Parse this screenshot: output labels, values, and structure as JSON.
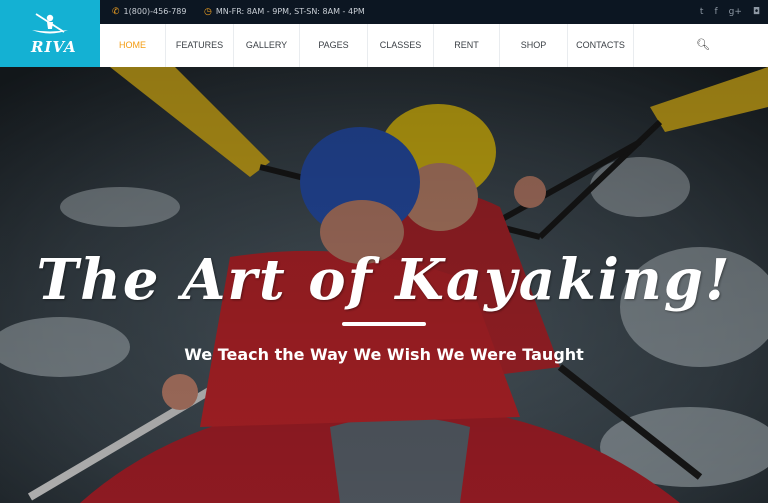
{
  "brand": {
    "name": "RIVA",
    "logo_icon": "kayaker-logo-icon",
    "color": "#14b1d3"
  },
  "info": {
    "phone_icon": "phone-icon",
    "phone": "1(800)-456-789",
    "hours_icon": "clock-icon",
    "hours": "MN-FR: 8AM - 9PM, ST-SN: 8AM - 4PM"
  },
  "social": [
    "twitter-icon",
    "facebook-icon",
    "google-plus-icon",
    "instagram-icon"
  ],
  "social_glyphs": {
    "twitter": "t",
    "facebook": "f",
    "google_plus": "g+",
    "instagram": "◘"
  },
  "nav": {
    "items": [
      "HOME",
      "FEATURES",
      "GALLERY",
      "PAGES",
      "CLASSES",
      "RENT",
      "SHOP",
      "CONTACTS"
    ],
    "active": "HOME",
    "search_icon": "search-icon",
    "search_glyph": "🔍︎"
  },
  "hero": {
    "title": "The Art of Kayaking!",
    "subtitle": "We Teach the Way We Wish We Were Taught"
  },
  "colors": {
    "accent": "#f39c12",
    "topbar": "#0c1622"
  }
}
